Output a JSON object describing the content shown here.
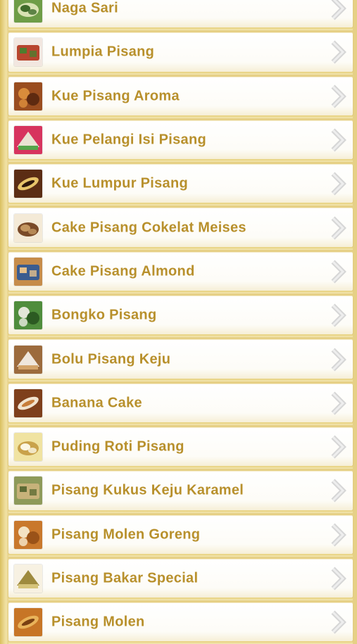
{
  "recipes": [
    {
      "title": "Naga Sari",
      "thumb": "naga-sari-photo",
      "colors": [
        "#6e9d47",
        "#d8e2b3",
        "#3f6b2a"
      ]
    },
    {
      "title": "Lumpia Pisang",
      "thumb": "lumpia-pisang-photo",
      "colors": [
        "#f2e7e0",
        "#b8452e",
        "#4e7d2e"
      ]
    },
    {
      "title": "Kue Pisang Aroma",
      "thumb": "kue-pisang-aroma-photo",
      "colors": [
        "#9a4d1f",
        "#d98c3b",
        "#5e2a10"
      ]
    },
    {
      "title": "Kue Pelangi Isi Pisang",
      "thumb": "kue-pelangi-isi-pisang-photo",
      "colors": [
        "#d7345e",
        "#e9e3d2",
        "#55a54a"
      ]
    },
    {
      "title": "Kue Lumpur Pisang",
      "thumb": "kue-lumpur-pisang-photo",
      "colors": [
        "#5b2d14",
        "#e7c46a",
        "#2e160a"
      ]
    },
    {
      "title": "Cake Pisang Cokelat Meises",
      "thumb": "cake-pisang-cokelat-meises-photo",
      "colors": [
        "#f4ead7",
        "#7a4a28",
        "#c49761"
      ]
    },
    {
      "title": "Cake Pisang Almond",
      "thumb": "cake-pisang-almond-photo",
      "colors": [
        "#c68c4a",
        "#3a5c8f",
        "#e5c08b"
      ]
    },
    {
      "title": "Bongko Pisang",
      "thumb": "bongko-pisang-photo",
      "colors": [
        "#4f8d3c",
        "#e2e6d8",
        "#2c5a22"
      ]
    },
    {
      "title": "Bolu Pisang Keju",
      "thumb": "bolu-pisang-keju-photo",
      "colors": [
        "#9c6b3c",
        "#efe7dc",
        "#d3a46a"
      ]
    },
    {
      "title": "Banana Cake",
      "thumb": "banana-cake-photo",
      "colors": [
        "#7e3f1b",
        "#f1e3cf",
        "#c77d3a"
      ]
    },
    {
      "title": "Puding Roti Pisang",
      "thumb": "puding-roti-pisang-photo",
      "colors": [
        "#f0e3a1",
        "#c9a24a",
        "#fbf7e4"
      ]
    },
    {
      "title": "Pisang Kukus Keju Karamel",
      "thumb": "pisang-kukus-keju-karamel-photo",
      "colors": [
        "#8e9a5a",
        "#c7b27a",
        "#5e6b35"
      ]
    },
    {
      "title": "Pisang Molen Goreng",
      "thumb": "pisang-molen-goreng-photo",
      "colors": [
        "#c9782c",
        "#f3e2c4",
        "#9a5218"
      ]
    },
    {
      "title": "Pisang Bakar Special",
      "thumb": "pisang-bakar-special-photo",
      "colors": [
        "#f7f1e2",
        "#9e8a3e",
        "#d6c47a"
      ]
    },
    {
      "title": "Pisang Molen",
      "thumb": "pisang-molen-photo",
      "colors": [
        "#c77526",
        "#e9b35a",
        "#7a4012"
      ]
    }
  ]
}
